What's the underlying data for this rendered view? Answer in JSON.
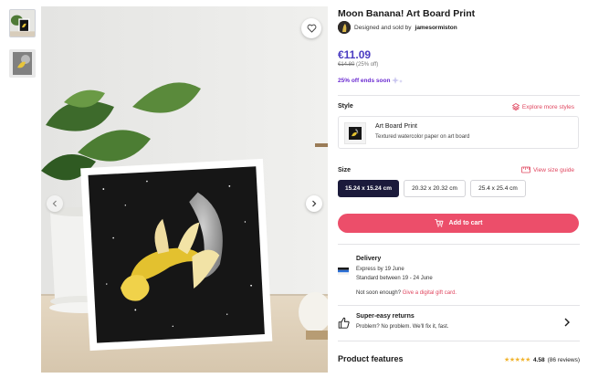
{
  "product": {
    "title": "Moon Banana! Art Board Print",
    "seller_prefix": "Designed and sold by",
    "seller_name": "jamesormiston"
  },
  "pricing": {
    "price": "€11.09",
    "old_price": "€14.80",
    "discount": "(25% off)",
    "promo": "25% off ends soon"
  },
  "style": {
    "label": "Style",
    "explore_link": "Explore more styles",
    "name": "Art Board Print",
    "description": "Textured watercolor paper on art board"
  },
  "size": {
    "label": "Size",
    "guide_link": "View size guide",
    "options": [
      "15.24 x 15.24 cm",
      "20.32 x 20.32 cm",
      "25.4 x 25.4 cm"
    ],
    "selected": "15.24 x 15.24 cm"
  },
  "cart": {
    "add_label": "Add to cart"
  },
  "delivery": {
    "title": "Delivery",
    "express": "Express by 19 June",
    "standard": "Standard between 19 - 24 June",
    "gift_prefix": "Not soon enough?",
    "gift_link": "Give a digital gift card."
  },
  "returns": {
    "title": "Super-easy returns",
    "subtitle": "Problem? No problem. We'll fix it, fast."
  },
  "features": {
    "title": "Product features",
    "rating": "4.58",
    "reviews": "(86 reviews)",
    "stars": "★★★★★"
  },
  "icons": {
    "favorite": "heart-icon",
    "next": "chevron-right-icon",
    "prev": "chevron-left-icon",
    "style": "layers-icon",
    "size_guide": "ruler-icon",
    "cart": "cart-icon",
    "returns": "thumbs-up-icon"
  },
  "colors": {
    "accent": "#ec4e6a",
    "price": "#4b3cc2",
    "promo": "#6b2bd1",
    "selected_size": "#1b1a3b",
    "stars": "#f1b42f"
  }
}
